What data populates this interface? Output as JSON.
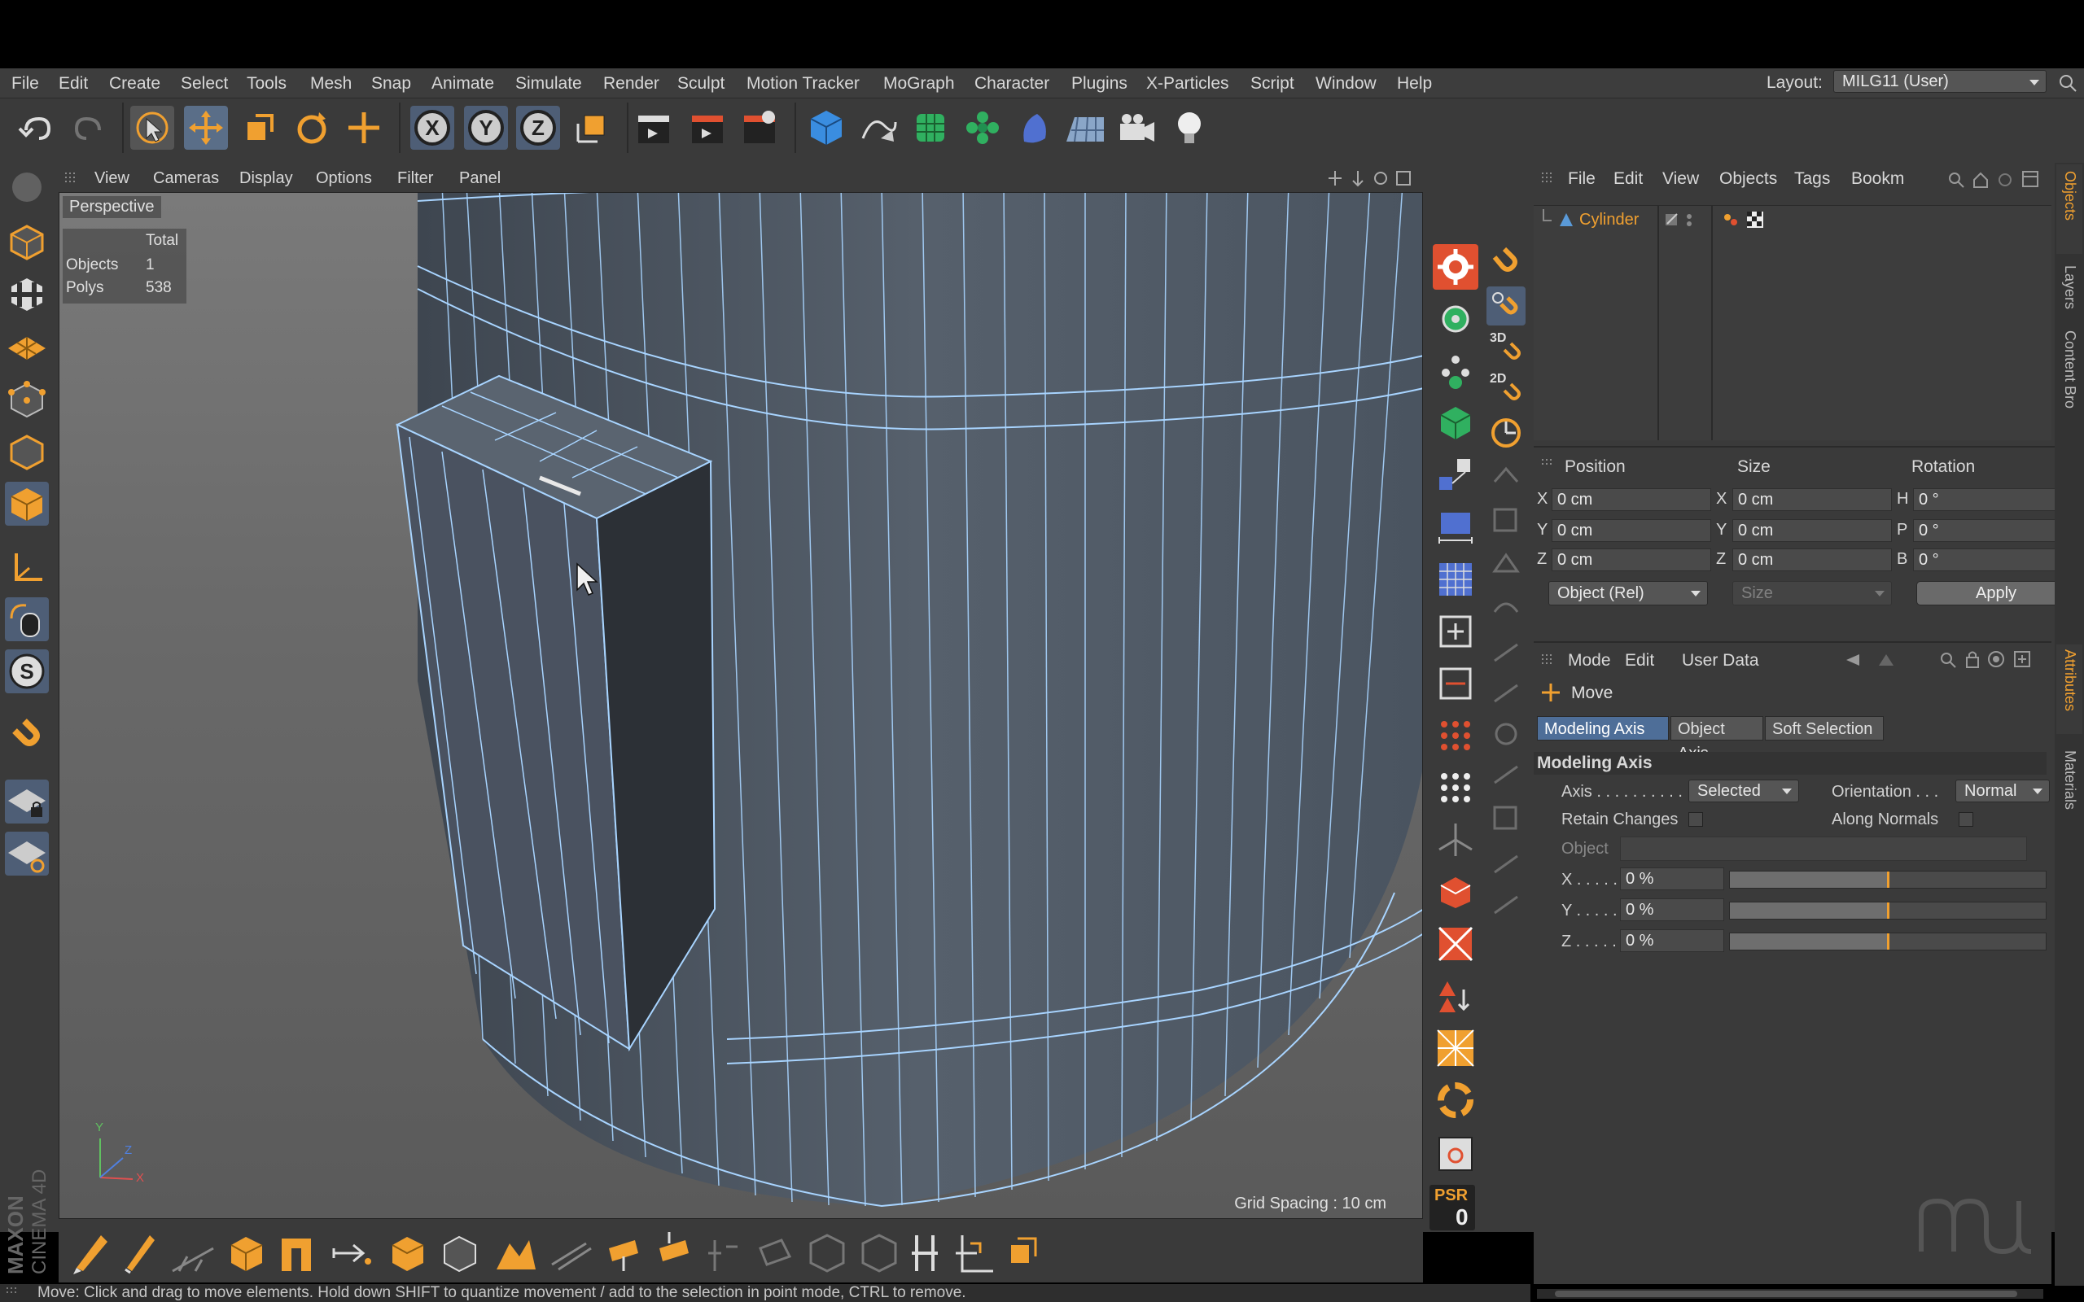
{
  "menubar": {
    "items": [
      "File",
      "Edit",
      "Create",
      "Select",
      "Tools",
      "Mesh",
      "Snap",
      "Animate",
      "Simulate",
      "Render",
      "Sculpt",
      "Motion Tracker",
      "MoGraph",
      "Character",
      "Plugins",
      "X-Particles",
      "Script",
      "Window",
      "Help"
    ],
    "layout_label": "Layout:",
    "layout_value": "MILG11 (User)"
  },
  "viewport": {
    "menu": [
      "View",
      "Cameras",
      "Display",
      "Options",
      "Filter",
      "Panel"
    ],
    "camera_label": "Perspective",
    "hud": {
      "header": "Total",
      "objects_label": "Objects",
      "objects_value": "1",
      "polys_label": "Polys",
      "polys_value": "538"
    },
    "grid_spacing": "Grid Spacing : 10 cm",
    "axis": {
      "x": "X",
      "y": "Y",
      "z": "Z"
    }
  },
  "status_text": "Move: Click and drag to move elements. Hold down SHIFT to quantize movement / add to the selection in point mode, CTRL to remove.",
  "psr": {
    "label": "PSR",
    "value": "0"
  },
  "brand": "MAXON CINEMA 4D",
  "object_manager": {
    "menu": [
      "File",
      "Edit",
      "View",
      "Objects",
      "Tags",
      "Bookm"
    ],
    "objects": [
      {
        "name": "Cylinder"
      }
    ]
  },
  "coordinates": {
    "headers": [
      "Position",
      "Size",
      "Rotation"
    ],
    "position": [
      {
        "axis": "X",
        "value": "0 cm"
      },
      {
        "axis": "Y",
        "value": "0 cm"
      },
      {
        "axis": "Z",
        "value": "0 cm"
      }
    ],
    "size": [
      {
        "axis": "X",
        "value": "0 cm"
      },
      {
        "axis": "Y",
        "value": "0 cm"
      },
      {
        "axis": "Z",
        "value": "0 cm"
      }
    ],
    "rotation": [
      {
        "axis": "H",
        "value": "0 °"
      },
      {
        "axis": "P",
        "value": "0 °"
      },
      {
        "axis": "B",
        "value": "0 °"
      }
    ],
    "mode_select": "Object (Rel)",
    "size_select": "Size",
    "apply_label": "Apply"
  },
  "attributes": {
    "menu": [
      "Mode",
      "Edit",
      "User Data"
    ],
    "tool_name": "Move",
    "tabs": [
      "Modeling Axis",
      "Object Axis",
      "Soft Selection"
    ],
    "section_title": "Modeling Axis",
    "axis_label": "Axis . . . . . . . . . . .",
    "axis_value": "Selected",
    "orientation_label": "Orientation . . .",
    "orientation_value": "Normal",
    "retain_label": "Retain Changes",
    "along_normals_label": "Along Normals",
    "object_label": "Object",
    "sliders": [
      {
        "label": "X . . . . .",
        "value": "0 %",
        "level": 0.5
      },
      {
        "label": "Y . . . . .",
        "value": "0 %",
        "level": 0.5
      },
      {
        "label": "Z . . . . .",
        "value": "0 %",
        "level": 0.5
      }
    ]
  },
  "side_tabs": [
    "Objects",
    "Layers",
    "Content Bro",
    "Attributes",
    "Materials"
  ],
  "colors": {
    "accent": "#f0a030",
    "wire": "#a8d4ff",
    "mesh": "#4a5562"
  }
}
